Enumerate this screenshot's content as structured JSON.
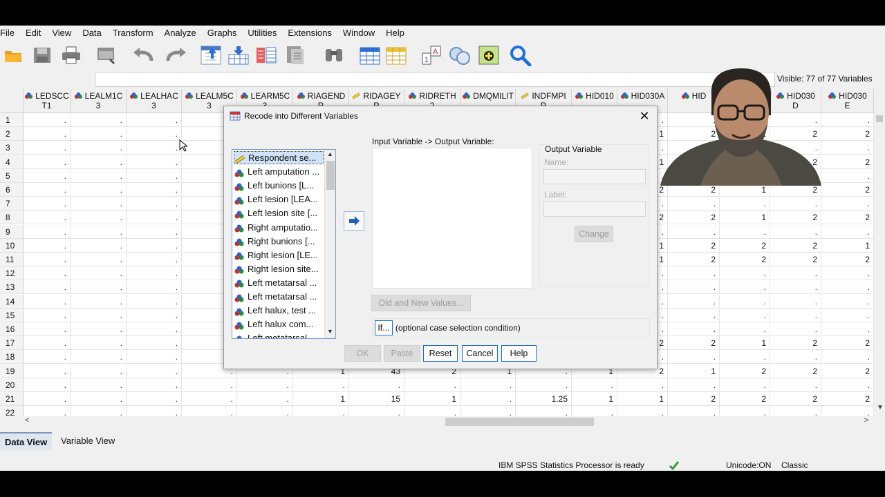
{
  "menu": [
    "File",
    "Edit",
    "View",
    "Data",
    "Transform",
    "Analyze",
    "Graphs",
    "Utilities",
    "Extensions",
    "Window",
    "Help"
  ],
  "toolbar": {
    "icons": [
      "open-folder-icon",
      "save-icon",
      "print-icon",
      "dialog-recall-icon",
      "undo-icon",
      "redo-icon",
      "goto-case-icon",
      "goto-variable-icon",
      "variables-icon",
      "run-descriptives-icon",
      "find-icon",
      "insert-cases-icon",
      "insert-variable-icon",
      "split-file-icon",
      "weight-cases-icon",
      "select-cases-icon",
      "value-labels-icon",
      "use-variable-sets-icon",
      "search-icon"
    ]
  },
  "visible_text": "Visible: 77 of 77 Variables",
  "columns": [
    {
      "line1": "LEDSCC",
      "line2": "T1",
      "icon": "nominal"
    },
    {
      "line1": "LEALM1C",
      "line2": "3",
      "icon": "nominal"
    },
    {
      "line1": "LEALHAC",
      "line2": "3",
      "icon": "nominal"
    },
    {
      "line1": "LEALM5C",
      "line2": "3",
      "icon": "nominal"
    },
    {
      "line1": "LEARM5C",
      "line2": "3",
      "icon": "nominal"
    },
    {
      "line1": "RIAGEND",
      "line2": "R",
      "icon": "nominal"
    },
    {
      "line1": "RIDAGEY",
      "line2": "R",
      "icon": "scale"
    },
    {
      "line1": "RIDRETH",
      "line2": "2",
      "icon": "nominal"
    },
    {
      "line1": "DMQMILIT",
      "line2": "",
      "icon": "nominal"
    },
    {
      "line1": "INDFMPI",
      "line2": "R",
      "icon": "scale"
    },
    {
      "line1": "HID010",
      "line2": "",
      "icon": "nominal"
    },
    {
      "line1": "HID030A",
      "line2": "",
      "icon": "nominal"
    },
    {
      "line1": "HID",
      "line2": "",
      "icon": "nominal"
    },
    {
      "line1": "HID030",
      "line2": "C",
      "icon": "nominal"
    },
    {
      "line1": "HID030",
      "line2": "D",
      "icon": "nominal"
    },
    {
      "line1": "HID030",
      "line2": "E",
      "icon": "nominal"
    }
  ],
  "rows": [
    {
      "n": "1",
      "v": [
        ".",
        ".",
        ".",
        ".",
        ".",
        ".",
        ".",
        ".",
        ".",
        ".",
        ".",
        ".",
        ".",
        ".",
        ".",
        "."
      ]
    },
    {
      "n": "2",
      "v": [
        ".",
        ".",
        ".",
        ".",
        ".",
        ".",
        ".",
        ".",
        ".",
        ".",
        ".",
        "1",
        "2",
        "2",
        "2",
        "2"
      ]
    },
    {
      "n": "3",
      "v": [
        ".",
        ".",
        ".",
        ".",
        ".",
        ".",
        ".",
        ".",
        ".",
        ".",
        ".",
        ".",
        ".",
        ".",
        ".",
        "."
      ]
    },
    {
      "n": "4",
      "v": [
        ".",
        ".",
        ".",
        ".",
        ".",
        ".",
        ".",
        ".",
        ".",
        ".",
        ".",
        "1",
        "2",
        "2",
        "2",
        "2"
      ]
    },
    {
      "n": "5",
      "v": [
        ".",
        ".",
        ".",
        ".",
        ".",
        ".",
        ".",
        ".",
        ".",
        ".",
        ".",
        ".",
        ".",
        ".",
        ".",
        "."
      ]
    },
    {
      "n": "6",
      "v": [
        ".",
        ".",
        ".",
        ".",
        ".",
        ".",
        ".",
        ".",
        ".",
        ".",
        ".",
        "2",
        "2",
        "1",
        "2",
        "2"
      ]
    },
    {
      "n": "7",
      "v": [
        ".",
        ".",
        ".",
        ".",
        ".",
        ".",
        ".",
        ".",
        ".",
        ".",
        ".",
        ".",
        ".",
        ".",
        ".",
        "."
      ]
    },
    {
      "n": "8",
      "v": [
        ".",
        ".",
        ".",
        ".",
        ".",
        ".",
        ".",
        ".",
        ".",
        ".",
        ".",
        "2",
        "2",
        "1",
        "2",
        "2"
      ]
    },
    {
      "n": "9",
      "v": [
        ".",
        ".",
        ".",
        ".",
        ".",
        ".",
        ".",
        ".",
        ".",
        ".",
        ".",
        ".",
        ".",
        ".",
        ".",
        "."
      ]
    },
    {
      "n": "10",
      "v": [
        ".",
        ".",
        ".",
        ".",
        ".",
        ".",
        ".",
        ".",
        ".",
        ".",
        ".",
        "1",
        "2",
        "2",
        "2",
        "1"
      ]
    },
    {
      "n": "11",
      "v": [
        ".",
        ".",
        ".",
        ".",
        ".",
        ".",
        ".",
        ".",
        ".",
        ".",
        ".",
        "1",
        "2",
        "2",
        "2",
        "2"
      ]
    },
    {
      "n": "12",
      "v": [
        ".",
        ".",
        ".",
        ".",
        ".",
        ".",
        ".",
        ".",
        ".",
        ".",
        ".",
        ".",
        ".",
        ".",
        ".",
        "."
      ]
    },
    {
      "n": "13",
      "v": [
        ".",
        ".",
        ".",
        ".",
        ".",
        ".",
        ".",
        ".",
        ".",
        ".",
        ".",
        ".",
        ".",
        ".",
        ".",
        "."
      ]
    },
    {
      "n": "14",
      "v": [
        ".",
        ".",
        ".",
        ".",
        ".",
        ".",
        ".",
        ".",
        ".",
        ".",
        ".",
        ".",
        ".",
        ".",
        ".",
        "."
      ]
    },
    {
      "n": "15",
      "v": [
        ".",
        ".",
        ".",
        ".",
        ".",
        ".",
        ".",
        ".",
        ".",
        ".",
        ".",
        ".",
        ".",
        ".",
        ".",
        "."
      ]
    },
    {
      "n": "16",
      "v": [
        ".",
        ".",
        ".",
        ".",
        ".",
        ".",
        ".",
        ".",
        ".",
        ".",
        ".",
        ".",
        ".",
        ".",
        ".",
        "."
      ]
    },
    {
      "n": "17",
      "v": [
        ".",
        ".",
        ".",
        ".",
        ".",
        ".",
        ".",
        ".",
        ".",
        ".",
        ".",
        "2",
        "2",
        "1",
        "2",
        "2"
      ]
    },
    {
      "n": "18",
      "v": [
        ".",
        ".",
        ".",
        ".",
        ".",
        ".",
        ".",
        ".",
        ".",
        ".",
        ".",
        ".",
        ".",
        ".",
        ".",
        "."
      ]
    },
    {
      "n": "19",
      "v": [
        ".",
        ".",
        ".",
        ".",
        ".",
        "1",
        "43",
        "2",
        "1",
        ".",
        "1",
        "2",
        "1",
        "2",
        "2",
        "2"
      ]
    },
    {
      "n": "20",
      "v": [
        ".",
        ".",
        ".",
        ".",
        ".",
        ".",
        ".",
        ".",
        ".",
        ".",
        ".",
        ".",
        ".",
        ".",
        ".",
        "."
      ]
    },
    {
      "n": "21",
      "v": [
        ".",
        ".",
        ".",
        ".",
        ".",
        "1",
        "15",
        "1",
        ".",
        "1.25",
        "1",
        "1",
        "2",
        "2",
        "2",
        "2"
      ]
    },
    {
      "n": "22",
      "v": [
        ".",
        ".",
        ".",
        ".",
        ".",
        ".",
        ".",
        ".",
        ".",
        ".",
        ".",
        ".",
        ".",
        ".",
        ".",
        "."
      ]
    }
  ],
  "tabs": {
    "data_view": "Data View",
    "variable_view": "Variable View"
  },
  "status": {
    "processor": "IBM SPSS Statistics Processor is ready",
    "unicode": "Unicode:ON",
    "mode": "Classic"
  },
  "dialog": {
    "title": "Recode into Different Variables",
    "variables": [
      {
        "label": "Respondent se...",
        "icon": "scale"
      },
      {
        "label": "Left amputation ...",
        "icon": "nominal"
      },
      {
        "label": "Left bunions [L...",
        "icon": "nominal"
      },
      {
        "label": "Left lesion [LEA...",
        "icon": "nominal"
      },
      {
        "label": "Left lesion site [...",
        "icon": "nominal"
      },
      {
        "label": "Right amputatio...",
        "icon": "nominal"
      },
      {
        "label": "Right bunions [...",
        "icon": "nominal"
      },
      {
        "label": "Right lesion [LE...",
        "icon": "nominal"
      },
      {
        "label": "Right lesion site...",
        "icon": "nominal"
      },
      {
        "label": "Left metatarsal ...",
        "icon": "nominal"
      },
      {
        "label": "Left metatarsal ...",
        "icon": "nominal"
      },
      {
        "label": "Left halux, test ...",
        "icon": "nominal"
      },
      {
        "label": "Left halux com...",
        "icon": "nominal"
      },
      {
        "label": "Left metatarsal",
        "icon": "nominal"
      }
    ],
    "io_label": "Input Variable -> Output Variable:",
    "output_variable": "Output Variable",
    "name_label": "Name:",
    "label_label": "Label:",
    "change": "Change",
    "old_new": "Old and New Values...",
    "if_btn": "If...",
    "if_hint": "(optional case selection condition)",
    "ok": "OK",
    "paste": "Paste",
    "reset": "Reset",
    "cancel": "Cancel",
    "help": "Help"
  }
}
